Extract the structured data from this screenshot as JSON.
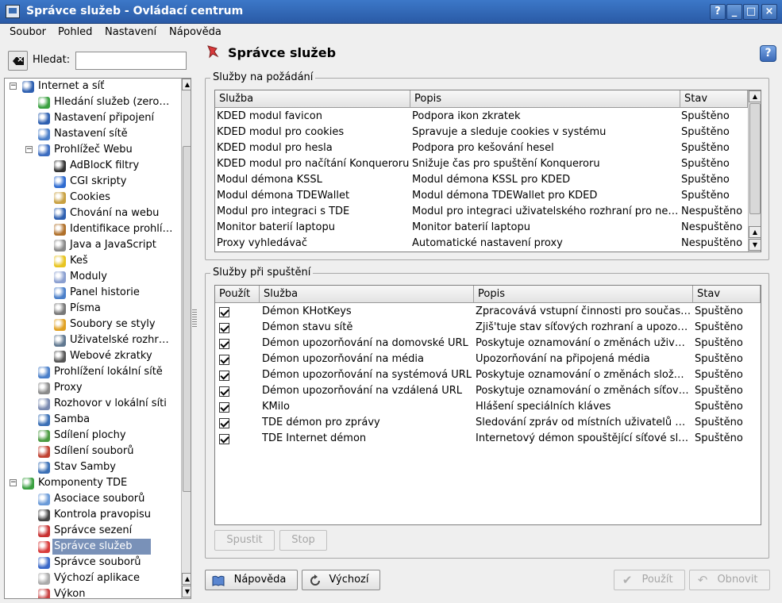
{
  "window": {
    "title": "Správce služeb - Ovládací centrum",
    "buttons": [
      "?",
      "_",
      "□",
      "×"
    ]
  },
  "menubar": [
    "Soubor",
    "Pohled",
    "Nastavení",
    "Nápověda"
  ],
  "search": {
    "label": "Hledat:",
    "value": ""
  },
  "tree": [
    {
      "label": "Internet a síť",
      "level": 0,
      "exp": "−",
      "icon": "globe-icon",
      "color": "#2d5fb0"
    },
    {
      "label": "Hledání služeb (zero…",
      "level": 1,
      "icon": "network-discovery-icon",
      "color": "#3aa040"
    },
    {
      "label": "Nastavení připojení",
      "level": 1,
      "icon": "globe-icon",
      "color": "#2d5fb0"
    },
    {
      "label": "Nastavení sítě",
      "level": 1,
      "icon": "network-icon",
      "color": "#4a7fc9"
    },
    {
      "label": "Prohlížeč Webu",
      "level": 1,
      "exp": "−",
      "icon": "globe-wrench-icon",
      "color": "#3b6cc0"
    },
    {
      "label": "AdBlocK filtry",
      "level": 2,
      "icon": "filter-icon",
      "color": "#333333"
    },
    {
      "label": "CGI skripty",
      "level": 2,
      "icon": "gear-icon",
      "color": "#2e6bd0"
    },
    {
      "label": "Cookies",
      "level": 2,
      "icon": "cookie-icon",
      "color": "#c8a040"
    },
    {
      "label": "Chování na webu",
      "level": 2,
      "icon": "globe-icon",
      "color": "#2d5fb0"
    },
    {
      "label": "Identifikace prohlí…",
      "level": 2,
      "icon": "identity-icon",
      "color": "#b0702a"
    },
    {
      "label": "Java a JavaScript",
      "level": 2,
      "icon": "java-icon",
      "color": "#888888"
    },
    {
      "label": "Keš",
      "level": 2,
      "icon": "cache-icon",
      "color": "#e8c420"
    },
    {
      "label": "Moduly",
      "level": 2,
      "icon": "plugin-icon",
      "color": "#8a9fd0"
    },
    {
      "label": "Panel historie",
      "level": 2,
      "icon": "clock-icon",
      "color": "#4a7fc9"
    },
    {
      "label": "Písma",
      "level": 2,
      "icon": "font-icon",
      "color": "#777777"
    },
    {
      "label": "Soubory se styly",
      "level": 2,
      "icon": "css-icon",
      "color": "#e0a020"
    },
    {
      "label": "Uživatelské rozhr…",
      "level": 2,
      "icon": "interface-icon",
      "color": "#607890"
    },
    {
      "label": "Webové zkratky",
      "level": 2,
      "icon": "shortcut-icon",
      "color": "#555555"
    },
    {
      "label": "Prohlížení lokální sítě",
      "level": 1,
      "icon": "lan-icon",
      "color": "#4a7fc9"
    },
    {
      "label": "Proxy",
      "level": 1,
      "icon": "proxy-icon",
      "color": "#8a8a8a"
    },
    {
      "label": "Rozhovor v lokální síti",
      "level": 1,
      "icon": "chat-icon",
      "color": "#7a8ab0"
    },
    {
      "label": "Samba",
      "level": 1,
      "icon": "samba-icon",
      "color": "#3a6fb5"
    },
    {
      "label": "Sdílení plochy",
      "level": 1,
      "icon": "desktop-share-icon",
      "color": "#4a9a40"
    },
    {
      "label": "Sdílení souborů",
      "level": 1,
      "icon": "file-share-icon",
      "color": "#c04030"
    },
    {
      "label": "Stav Samby",
      "level": 1,
      "icon": "samba-status-icon",
      "color": "#3a6fb5"
    },
    {
      "label": "Komponenty TDE",
      "level": 0,
      "exp": "−",
      "icon": "components-icon",
      "color": "#3aa040"
    },
    {
      "label": "Asociace souborů",
      "level": 1,
      "icon": "speech-icon",
      "color": "#6a9ad8"
    },
    {
      "label": "Kontrola pravopisu",
      "level": 1,
      "icon": "spellcheck-icon",
      "color": "#444444"
    },
    {
      "label": "Správce sezení",
      "level": 1,
      "icon": "session-icon",
      "color": "#c83030"
    },
    {
      "label": "Správce služeb",
      "level": 1,
      "icon": "service-icon",
      "color": "#d83a3a",
      "selected": true
    },
    {
      "label": "Správce souborů",
      "level": 1,
      "icon": "cube-icon",
      "color": "#3a68c8"
    },
    {
      "label": "Výchozí aplikace",
      "level": 1,
      "icon": "document-icon",
      "color": "#aaaaaa"
    },
    {
      "label": "Výkon",
      "level": 1,
      "icon": "performance-icon",
      "color": "#c84040"
    }
  ],
  "module": {
    "title": "Správce služeb",
    "help": "?"
  },
  "ondemand": {
    "title": "Služby na požádání",
    "headers": [
      "Služba",
      "Popis",
      "Stav"
    ],
    "rows": [
      [
        "KDED modul favicon",
        "Podpora ikon zkratek",
        "Spuštěno"
      ],
      [
        "KDED modul pro cookies",
        "Spravuje a sleduje cookies v systému",
        "Spuštěno"
      ],
      [
        "KDED modul pro hesla",
        "Podpora pro kešování hesel",
        "Spuštěno"
      ],
      [
        "KDED modul pro načítání Konqueroru",
        "Snižuje čas pro spuštění Konqueroru",
        "Spuštěno"
      ],
      [
        "Modul démona KSSL",
        "Modul démona KSSL pro KDED",
        "Spuštěno"
      ],
      [
        "Modul démona TDEWallet",
        "Modul démona TDEWallet pro KDED",
        "Spuštěno"
      ],
      [
        "Modul pro integraci s TDE",
        "Modul pro integraci uživatelského rozhraní pro ne…",
        "Nespuštěno"
      ],
      [
        "Monitor baterií laptopu",
        "Monitor baterií laptopu",
        "Nespuštěno"
      ],
      [
        "Proxy vyhledávač",
        "Automatické nastavení proxy",
        "Nespuštěno"
      ]
    ]
  },
  "startup": {
    "title": "Služby při spuštění",
    "headers": [
      "Použít",
      "Služba",
      "Popis",
      "Stav"
    ],
    "rows": [
      [
        "Démon KHotKeys",
        "Zpracovává vstupní činnosti pro součas…",
        "Spuštěno"
      ],
      [
        "Démon stavu sítě",
        "Zjiš'tuje stav síťových rozhraní a upozo…",
        "Spuštěno"
      ],
      [
        "Démon upozorňování na domovské URL",
        "Poskytuje oznamování o změnách uživ…",
        "Spuštěno"
      ],
      [
        "Démon upozorňování na média",
        "Upozorňování na připojená média",
        "Spuštěno"
      ],
      [
        "Démon upozorňování na systémová URL",
        "Poskytuje oznamování o změnách slož…",
        "Spuštěno"
      ],
      [
        "Démon upozorňování na vzdálená URL",
        "Poskytuje oznamování o změnách síťov…",
        "Spuštěno"
      ],
      [
        "KMilo",
        "Hlášení speciálních kláves",
        "Spuštěno"
      ],
      [
        "TDE démon pro zprávy",
        "Sledování zpráv od místních uživatelů …",
        "Spuštěno"
      ],
      [
        "TDE Internet démon",
        "Internetový démon spouštějící síťové sl…",
        "Spuštěno"
      ]
    ],
    "start_btn": "Spustit",
    "stop_btn": "Stop"
  },
  "footer": {
    "help": "Nápověda",
    "defaults": "Výchozí",
    "apply": "Použít",
    "reset": "Obnovit"
  }
}
